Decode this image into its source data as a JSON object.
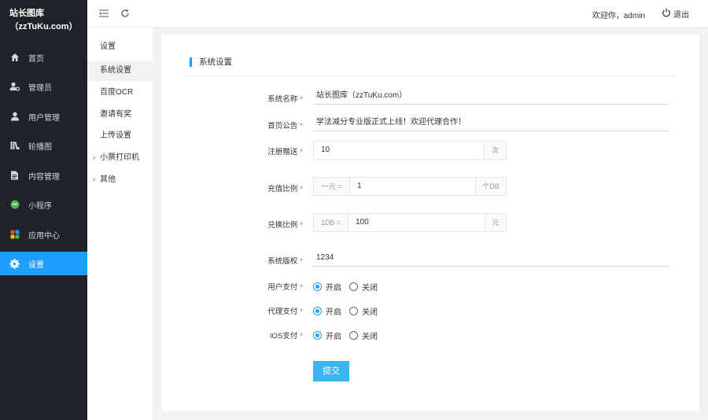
{
  "brand": {
    "line1": "站长图库",
    "line2": "（zzTuKu.com）"
  },
  "sidebar": {
    "items": [
      {
        "label": "首页",
        "icon": "home-icon"
      },
      {
        "label": "管理员",
        "icon": "admin-user-icon"
      },
      {
        "label": "用户管理",
        "icon": "user-icon"
      },
      {
        "label": "轮播图",
        "icon": "carousel-icon"
      },
      {
        "label": "内容管理",
        "icon": "content-icon"
      },
      {
        "label": "小程序",
        "icon": "miniprogram-icon"
      },
      {
        "label": "应用中心",
        "icon": "apps-icon"
      },
      {
        "label": "设置",
        "icon": "gear-icon",
        "active": true
      }
    ]
  },
  "header": {
    "welcome": "欢迎你，admin",
    "logout": "退出"
  },
  "submenu": {
    "title": "设置",
    "items": [
      {
        "label": "系统设置",
        "active": true
      },
      {
        "label": "百度OCR"
      },
      {
        "label": "邀请有奖"
      },
      {
        "label": "上传设置"
      },
      {
        "label": "小票打印机",
        "expandable": true
      },
      {
        "label": "其他",
        "expandable": true
      }
    ]
  },
  "form": {
    "title": "系统设置",
    "site_name": {
      "label": "系统名称",
      "value": "站长图库（zzTuKu.com）"
    },
    "notice": {
      "label": "首页公告",
      "value": "学法减分专业版正式上线！欢迎代理合作！"
    },
    "register_gift": {
      "label": "注册赠送",
      "value": "10",
      "suffix": "次"
    },
    "recharge_ratio": {
      "label": "充值比例",
      "prefix": "一元 =",
      "value": "1",
      "suffix": "个DB"
    },
    "exchange_ratio": {
      "label": "兑换比例",
      "prefix": "1DB =",
      "value": "100",
      "suffix": "元"
    },
    "copyright": {
      "label": "系统版权",
      "value": "1234"
    },
    "user_pay": {
      "label": "用户支付",
      "on": "开启",
      "off": "关闭",
      "selected": "on"
    },
    "agent_pay": {
      "label": "代理支付",
      "on": "开启",
      "off": "关闭",
      "selected": "on"
    },
    "ios_pay": {
      "label": "IOS支付",
      "on": "开启",
      "off": "关闭",
      "selected": "on"
    },
    "required_mark": "*",
    "submit": "提交"
  },
  "colors": {
    "accent": "#1e9fff",
    "sidebar_bg": "#20222a",
    "submit_bg": "#3bb4f2",
    "required": "#ff5722"
  }
}
